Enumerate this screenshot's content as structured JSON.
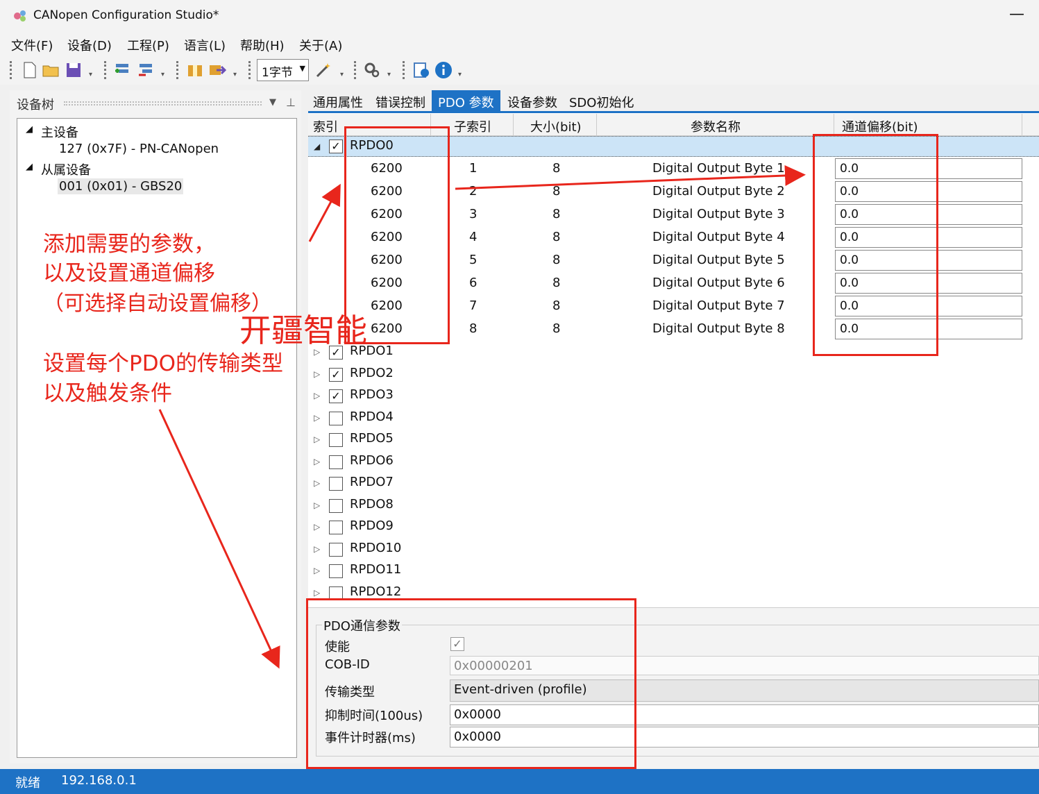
{
  "window": {
    "title": "CANopen Configuration Studio*",
    "minimize": "—"
  },
  "menu": [
    "文件(F)",
    "设备(D)",
    "工程(P)",
    "语言(L)",
    "帮助(H)",
    "关于(A)"
  ],
  "toolbar": {
    "byte_select": "1字节"
  },
  "left_panel": {
    "title": "设备树",
    "tree": {
      "master_label": "主设备",
      "master_item": "127 (0x7F)  -  PN-CANopen",
      "slave_label": "从属设备",
      "slave_item": "001 (0x01)  -  GBS20"
    }
  },
  "annotations": {
    "line1": "添加需要的参数，",
    "line2": "以及设置通道偏移",
    "line3": "（可选择自动设置偏移）",
    "brand": "开疆智能",
    "line4": "设置每个PDO的传输类型",
    "line5": "以及触发条件"
  },
  "tabs": [
    "通用属性",
    "错误控制",
    "PDO 参数",
    "设备参数",
    "SDO初始化"
  ],
  "grid": {
    "columns": [
      "索引",
      "子索引",
      "大小(bit)",
      "参数名称",
      "通道偏移(bit)"
    ],
    "expanded_pdo": "RPDO0",
    "rows": [
      {
        "index": "6200",
        "sub": "1",
        "size": "8",
        "name": "Digital Output Byte 1",
        "offset": "0.0"
      },
      {
        "index": "6200",
        "sub": "2",
        "size": "8",
        "name": "Digital Output Byte 2",
        "offset": "0.0"
      },
      {
        "index": "6200",
        "sub": "3",
        "size": "8",
        "name": "Digital Output Byte 3",
        "offset": "0.0"
      },
      {
        "index": "6200",
        "sub": "4",
        "size": "8",
        "name": "Digital Output Byte 4",
        "offset": "0.0"
      },
      {
        "index": "6200",
        "sub": "5",
        "size": "8",
        "name": "Digital Output Byte 5",
        "offset": "0.0"
      },
      {
        "index": "6200",
        "sub": "6",
        "size": "8",
        "name": "Digital Output Byte 6",
        "offset": "0.0"
      },
      {
        "index": "6200",
        "sub": "7",
        "size": "8",
        "name": "Digital Output Byte 7",
        "offset": "0.0"
      },
      {
        "index": "6200",
        "sub": "8",
        "size": "8",
        "name": "Digital Output Byte 8",
        "offset": "0.0"
      }
    ],
    "pdos": [
      {
        "name": "RPDO1",
        "checked": true
      },
      {
        "name": "RPDO2",
        "checked": true
      },
      {
        "name": "RPDO3",
        "checked": true
      },
      {
        "name": "RPDO4",
        "checked": false
      },
      {
        "name": "RPDO5",
        "checked": false
      },
      {
        "name": "RPDO6",
        "checked": false
      },
      {
        "name": "RPDO7",
        "checked": false
      },
      {
        "name": "RPDO8",
        "checked": false
      },
      {
        "name": "RPDO9",
        "checked": false
      },
      {
        "name": "RPDO10",
        "checked": false
      },
      {
        "name": "RPDO11",
        "checked": false
      },
      {
        "name": "RPDO12",
        "checked": false
      }
    ]
  },
  "pdo_comm": {
    "title": "PDO通信参数",
    "enable_label": "使能",
    "enable_checked": true,
    "cobid_label": "COB-ID",
    "cobid_value": "0x00000201",
    "trans_label": "传输类型",
    "trans_value": "Event-driven (profile)",
    "inhibit_label": "抑制时间(100us)",
    "inhibit_value": "0x0000",
    "event_label": "事件计时器(ms)",
    "event_value": "0x0000"
  },
  "status": {
    "text": "就绪",
    "ip": "192.168.0.1"
  },
  "colors": {
    "accent": "#1e72c5",
    "annotation": "#e8261c",
    "selected_row": "#cce4f7"
  }
}
